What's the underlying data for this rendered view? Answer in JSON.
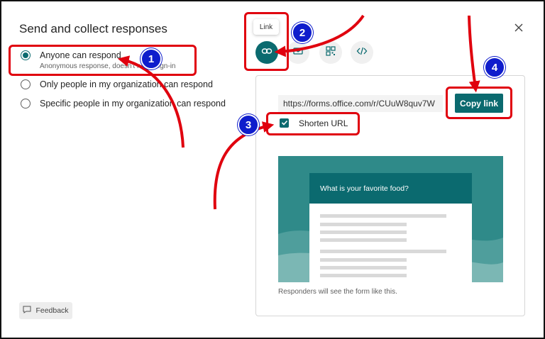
{
  "dialog": {
    "title": "Send and collect responses",
    "close_icon": "close-icon"
  },
  "options": [
    {
      "label": "Anyone can respond",
      "sublabel": "Anonymous response, doesn't need sign-in",
      "selected": true
    },
    {
      "label": "Only people in my organization can respond",
      "selected": false
    },
    {
      "label": "Specific people in my organization can respond",
      "selected": false
    }
  ],
  "share_tabs": {
    "tooltip": "Link",
    "icons": [
      "link-icon",
      "email-icon",
      "qr-code-icon",
      "embed-code-icon"
    ]
  },
  "link_panel": {
    "url": "https://forms.office.com/r/CUuW8quv7W",
    "copy_label": "Copy link",
    "shorten_label": "Shorten URL",
    "shorten_checked": true,
    "preview_question": "What is your favorite food?",
    "caption": "Responders will see the form like this."
  },
  "feedback_label": "Feedback",
  "annotations": [
    "1",
    "2",
    "3",
    "4"
  ],
  "colors": {
    "accent": "#0b6a6f",
    "annotation_red": "#e0000e",
    "annotation_blue": "#0f1dcc"
  }
}
